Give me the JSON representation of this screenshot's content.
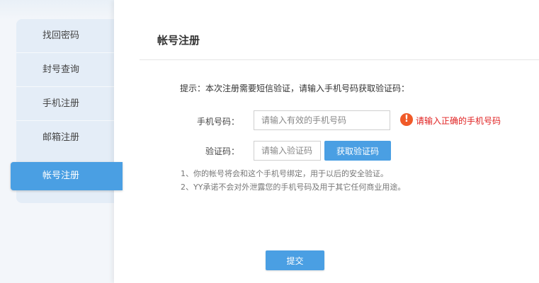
{
  "sidebar": {
    "items": [
      {
        "label": "找回密码"
      },
      {
        "label": "封号查询"
      },
      {
        "label": "手机注册"
      },
      {
        "label": "邮箱注册"
      },
      {
        "label": "帐号注册"
      }
    ],
    "active_index": 4
  },
  "main": {
    "title": "帐号注册",
    "hint": "提示：本次注册需要短信验证，请输入手机号码获取验证码：",
    "phone": {
      "label": "手机号码：",
      "value": "",
      "placeholder": "请输入有效的手机号码",
      "error": "请输入正确的手机号码",
      "error_icon": "!"
    },
    "code": {
      "label": "验证码：",
      "value": "",
      "placeholder": "请输入验证码",
      "button": "获取验证码"
    },
    "notes": [
      "1、你的帐号将会和这个手机号绑定，用于以后的安全验证。",
      "2、YY承诺不会对外泄露您的手机号码及用于其它任何商业用途。"
    ],
    "submit": "提交"
  },
  "colors": {
    "accent": "#4a9fe3",
    "error": "#e02020",
    "sidebar_bg": "#e4edf7"
  }
}
